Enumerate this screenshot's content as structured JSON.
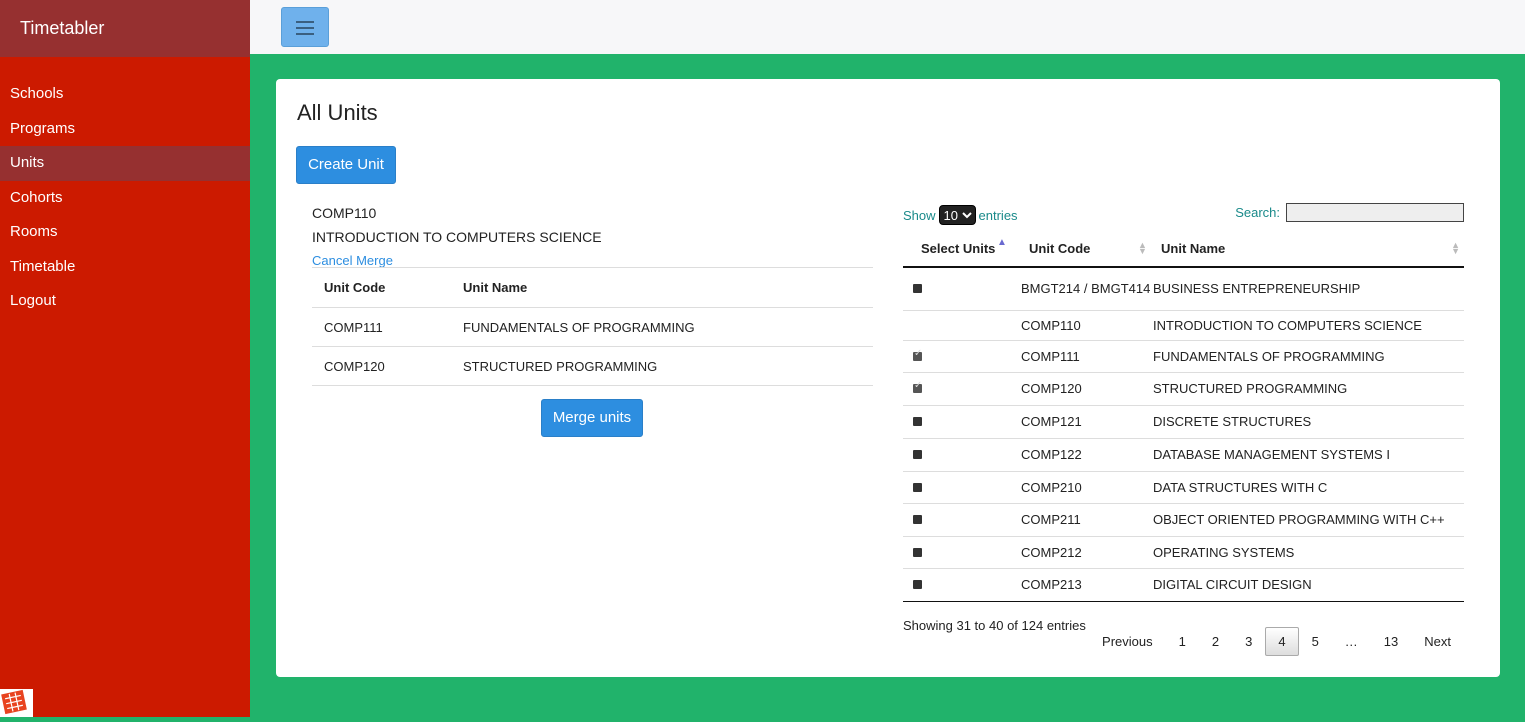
{
  "app": {
    "brand": "Timetabler"
  },
  "sidebar": {
    "items": [
      {
        "label": "Schools"
      },
      {
        "label": "Programs"
      },
      {
        "label": "Units"
      },
      {
        "label": "Cohorts"
      },
      {
        "label": "Rooms"
      },
      {
        "label": "Timetable"
      },
      {
        "label": "Logout"
      }
    ],
    "active": "Units"
  },
  "page": {
    "title": "All Units",
    "create_button": "Create Unit"
  },
  "merge": {
    "code": "COMP110",
    "name": "INTRODUCTION TO COMPUTERS SCIENCE",
    "cancel_label": "Cancel Merge",
    "headers": {
      "code": "Unit Code",
      "name": "Unit Name"
    },
    "rows": [
      {
        "code": "COMP111",
        "name": "FUNDAMENTALS OF PROGRAMMING"
      },
      {
        "code": "COMP120",
        "name": "STRUCTURED PROGRAMMING"
      }
    ],
    "merge_button": "Merge units"
  },
  "datatable": {
    "show_label": "Show",
    "entries_value": "10",
    "entries_label": "entries",
    "search_label": "Search:",
    "search_value": "",
    "headers": {
      "select": "Select Units",
      "code": "Unit Code",
      "name": "Unit Name"
    },
    "rows": [
      {
        "checkbox": "unchecked",
        "code": "BMGT214 / BMGT414",
        "name": "BUSINESS ENTREPRENEURSHIP"
      },
      {
        "checkbox": "none",
        "code": "COMP110",
        "name": "INTRODUCTION TO COMPUTERS SCIENCE"
      },
      {
        "checkbox": "checked",
        "code": "COMP111",
        "name": "FUNDAMENTALS OF PROGRAMMING"
      },
      {
        "checkbox": "checked",
        "code": "COMP120",
        "name": "STRUCTURED PROGRAMMING"
      },
      {
        "checkbox": "unchecked",
        "code": "COMP121",
        "name": "DISCRETE STRUCTURES"
      },
      {
        "checkbox": "unchecked",
        "code": "COMP122",
        "name": "DATABASE MANAGEMENT SYSTEMS I"
      },
      {
        "checkbox": "unchecked",
        "code": "COMP210",
        "name": "DATA STRUCTURES WITH C"
      },
      {
        "checkbox": "unchecked",
        "code": "COMP211",
        "name": "OBJECT ORIENTED PROGRAMMING WITH C++"
      },
      {
        "checkbox": "unchecked",
        "code": "COMP212",
        "name": "OPERATING SYSTEMS"
      },
      {
        "checkbox": "unchecked",
        "code": "COMP213",
        "name": "DIGITAL CIRCUIT DESIGN"
      }
    ],
    "info": "Showing 31 to 40 of 124 entries",
    "pagination": {
      "previous": "Previous",
      "pages": [
        "1",
        "2",
        "3",
        "4",
        "5",
        "…",
        "13"
      ],
      "current": "4",
      "next": "Next"
    }
  },
  "colors": {
    "sidebar": "#cc1a00",
    "sidebar_active": "#963030",
    "background": "#21b36b",
    "primary_button": "#2d8ee0"
  }
}
